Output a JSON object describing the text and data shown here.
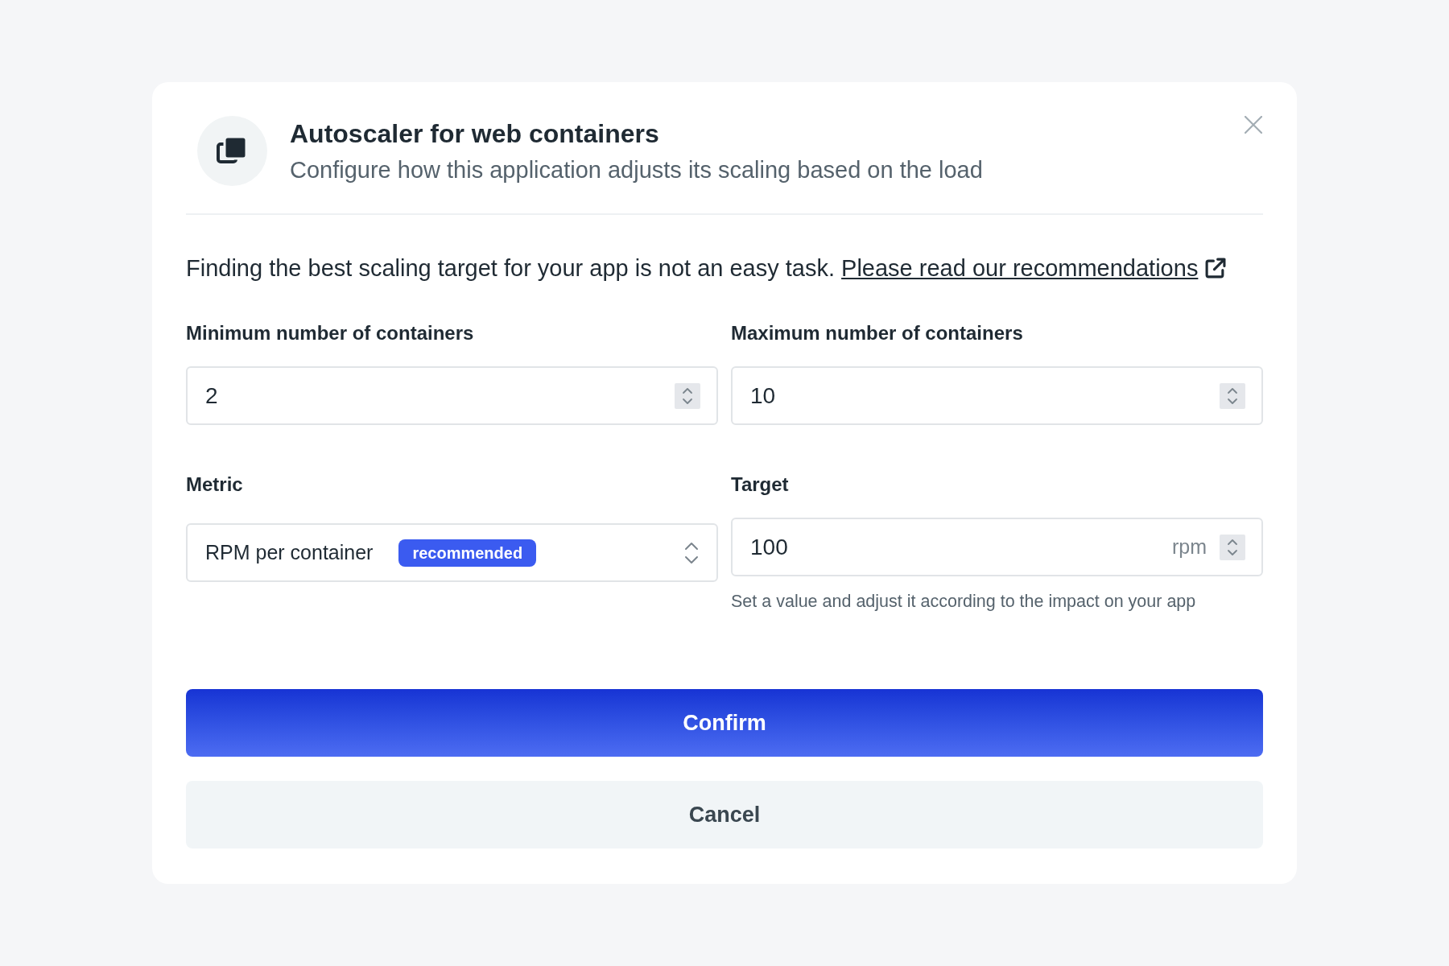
{
  "dialog": {
    "title": "Autoscaler for web containers",
    "subtitle": "Configure how this application adjusts its scaling based on the load",
    "intro": {
      "text": "Finding the best scaling target for your app is not an easy task.",
      "link": "Please read our recommendations"
    },
    "fields": [
      {
        "kind": "number",
        "label": "Minimum number of containers",
        "value": "2"
      },
      {
        "kind": "number",
        "label": "Maximum number of containers",
        "value": "10"
      },
      {
        "kind": "select",
        "label": "Metric",
        "value": "RPM per container",
        "badge": "recommended"
      },
      {
        "kind": "number",
        "label": "Target",
        "value": "100",
        "unit": "rpm",
        "hint": "Set a value and adjust it according to the impact on your app"
      }
    ],
    "buttons": [
      {
        "kind": "primary",
        "label": "Confirm"
      },
      {
        "kind": "secondary",
        "label": "Cancel"
      }
    ]
  }
}
